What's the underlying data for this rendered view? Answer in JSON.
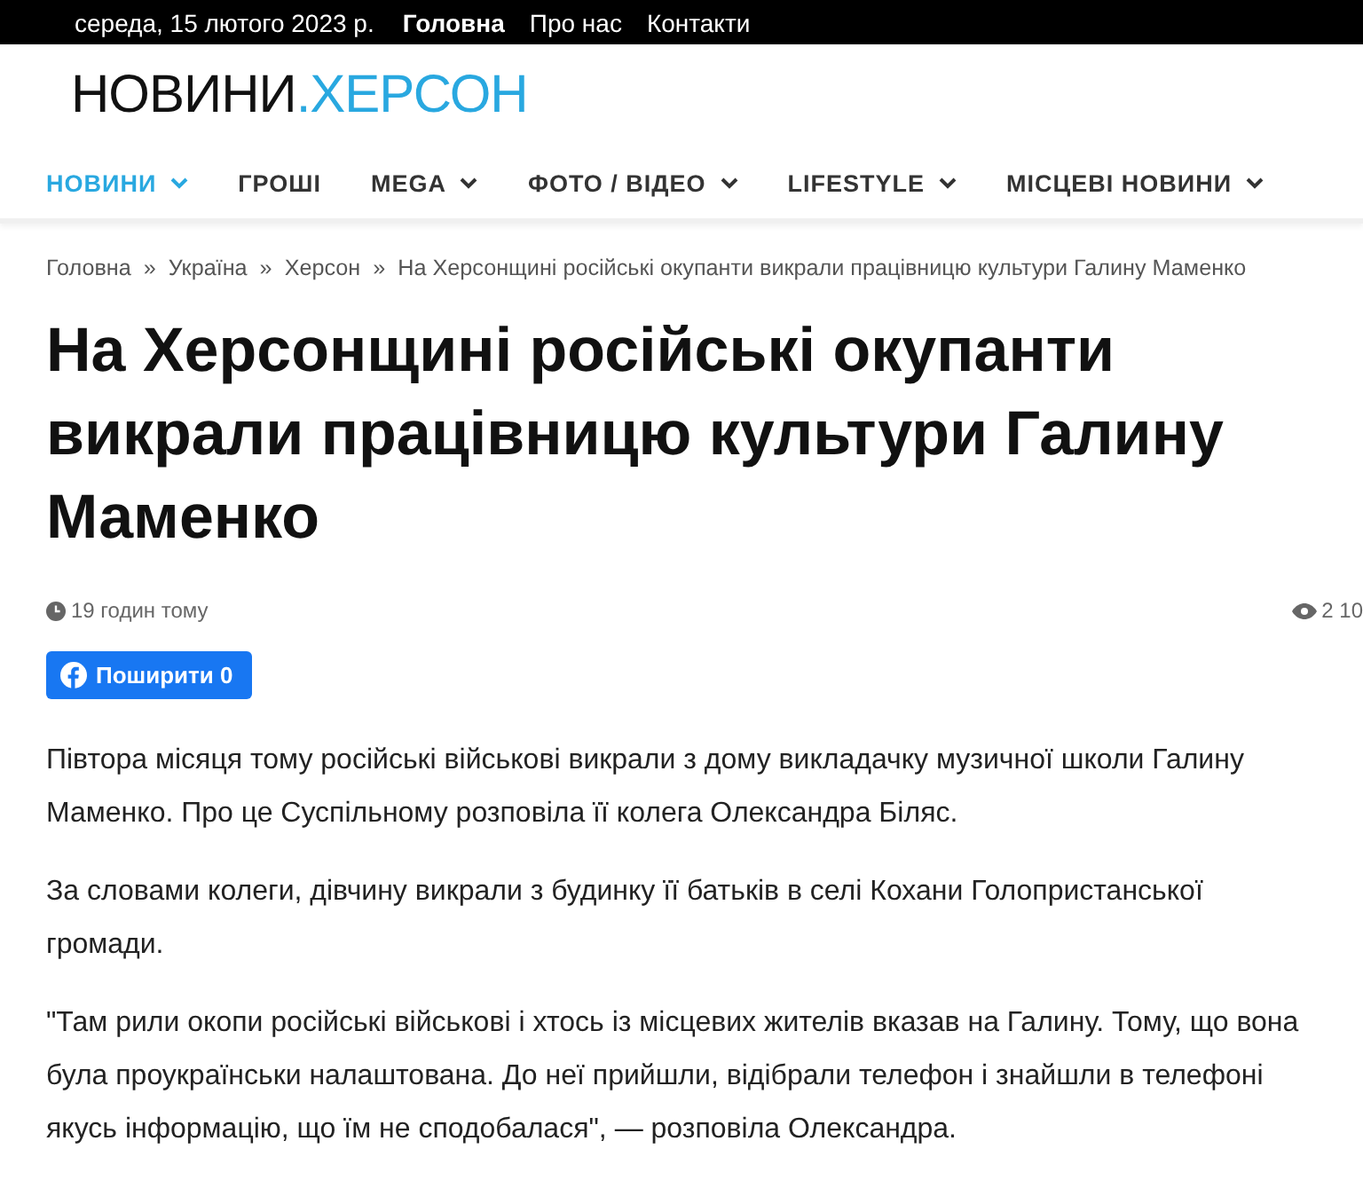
{
  "top_bar": {
    "date": "середа, 15 лютого 2023 р.",
    "links": [
      "Головна",
      "Про нас",
      "Контакти"
    ]
  },
  "logo": {
    "part_1": "НОВИНИ",
    "part_2": ".ХЕРСОН"
  },
  "nav": [
    {
      "label": "НОВИНИ",
      "selected": true,
      "has_dropdown": true
    },
    {
      "label": "ГРОШІ",
      "selected": false,
      "has_dropdown": false
    },
    {
      "label": "MEGA",
      "selected": false,
      "has_dropdown": true
    },
    {
      "label": "ФОТО / ВІДЕО",
      "selected": false,
      "has_dropdown": true
    },
    {
      "label": "LIFESTYLE",
      "selected": false,
      "has_dropdown": true
    },
    {
      "label": "МІСЦЕВІ НОВИНИ",
      "selected": false,
      "has_dropdown": true
    }
  ],
  "breadcrumbs": [
    {
      "label": "Головна"
    },
    {
      "label": "Україна"
    },
    {
      "label": "Херсон"
    },
    {
      "label": "На Херсонщині російські окупанти викрали працівницю культури Галину Маменко"
    }
  ],
  "breadcrumb_separator": "»",
  "article": {
    "title": "На Херсонщині російські окупанти викрали працівницю культури Галину Маменко",
    "time": "19 годин тому",
    "views": "2 10",
    "share_button": "Поширити 0",
    "paragraphs": [
      "Півтора місяця тому російські військові викрали з дому викладачку музичної школи Галину Маменко. Про це Суспільному розповіла її колега Олександра Біляс.",
      "За словами колеги, дівчину викрали з будинку її батьків в селі Кохани Голопристанської громади.",
      "\"Там рили окопи російські військові і хтось із місцевих жителів вказав на Галину. Тому, що вона була проукраїнськи налаштована. До неї прийшли, відібрали телефон і знайшли в телефоні якусь інформацію, що їм не сподобалася\", — розповіла Олександра."
    ]
  }
}
